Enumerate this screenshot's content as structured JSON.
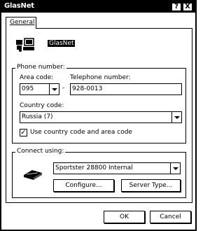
{
  "window": {
    "title": "GlasNet",
    "help_glyph": "?",
    "close_glyph": "X"
  },
  "tab": {
    "label": "General"
  },
  "connection": {
    "name": "GlasNet",
    "icon": "phone-connection-icon"
  },
  "phone_group": {
    "title": "Phone number:",
    "area_code_label": "Area code:",
    "area_code_value": "095",
    "dash": "-",
    "telephone_label": "Telephone number:",
    "telephone_value": "928-0013",
    "country_label": "Country code:",
    "country_value": "Russia (7)",
    "checkbox_label": "Use country code and area code",
    "checkbox_checked": true,
    "checkbox_glyph": "✓"
  },
  "connect_group": {
    "title": "Connect using:",
    "modem_icon": "modem-icon",
    "device_value": "Sportster 28800 Internal",
    "configure_label": "Configure...",
    "server_type_label": "Server Type..."
  },
  "footer": {
    "ok_label": "OK",
    "cancel_label": "Cancel"
  }
}
